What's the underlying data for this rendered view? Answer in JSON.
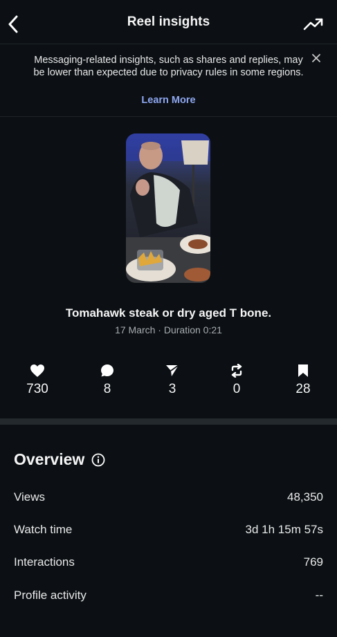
{
  "header": {
    "title": "Reel insights"
  },
  "notice": {
    "message": "Messaging-related insights, such as shares and replies, may be lower than expected due to privacy rules in some regions.",
    "link": "Learn More"
  },
  "reel": {
    "title": "Tomahawk steak or dry aged T bone.",
    "meta": "17 March · Duration 0:21"
  },
  "stats": {
    "likes": "730",
    "comments": "8",
    "shares": "3",
    "reposts": "0",
    "saves": "28"
  },
  "overview": {
    "title": "Overview",
    "rows": [
      {
        "label": "Views",
        "value": "48,350"
      },
      {
        "label": "Watch time",
        "value": "3d 1h 15m 57s"
      },
      {
        "label": "Interactions",
        "value": "769"
      },
      {
        "label": "Profile activity",
        "value": "--"
      }
    ]
  },
  "colors": {
    "background": "#0c1014",
    "link": "#8ea6f0",
    "divider": "#24292e"
  }
}
